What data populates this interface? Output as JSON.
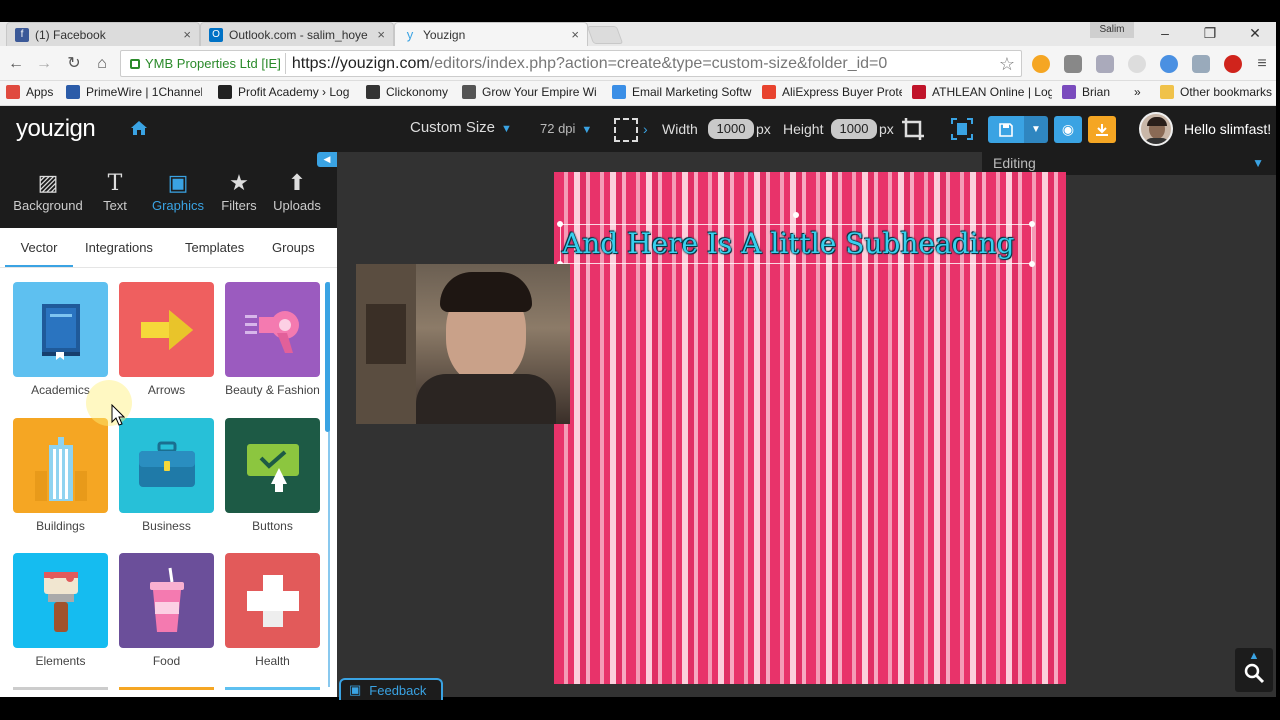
{
  "browser": {
    "tabs": [
      {
        "label": "(1) Facebook",
        "icon": "facebook-icon",
        "color": "#3b5998"
      },
      {
        "label": "Outlook.com - salim_hoye",
        "icon": "outlook-icon",
        "color": "#0072c6"
      },
      {
        "label": "Youzign",
        "icon": "youzign-icon",
        "color": "#3aa3e3"
      }
    ],
    "profile_name": "Salim",
    "ev_label": "YMB Properties Ltd [IE]",
    "url_host": "https://youzign.com",
    "url_path": "/editors/index.php?action=create&type=custom-size&folder_id=0",
    "bookmarks": [
      {
        "label": "Apps",
        "color": "#e04a3f"
      },
      {
        "label": "PrimeWire | 1Channel",
        "color": "#2b5ba8"
      },
      {
        "label": "Profit Academy › Log",
        "color": "#222222"
      },
      {
        "label": "Clickonomy",
        "color": "#333333"
      },
      {
        "label": "Grow Your Empire Wi",
        "color": "#555555"
      },
      {
        "label": "Email Marketing Softw",
        "color": "#3a8ee6"
      },
      {
        "label": "AliExpress Buyer Prote",
        "color": "#e8432e"
      },
      {
        "label": "ATHLEAN Online | Log",
        "color": "#c0142a"
      },
      {
        "label": "Brian",
        "color": "#7a4bbd"
      },
      {
        "label": "»",
        "color": "#f5f5f5"
      },
      {
        "label": "Other bookmarks",
        "color": "#f0c24a"
      }
    ]
  },
  "app": {
    "logo": "youzign",
    "size_select": "Custom Size",
    "dpi_select": "72 dpi",
    "width_label": "Width",
    "width_value": "1000",
    "height_label": "Height",
    "height_value": "1000",
    "unit": "px",
    "greeting": "Hello slimfast!",
    "editing_label": "Editing",
    "feedback_label": "Feedback"
  },
  "toolbar": [
    {
      "label": "Background",
      "icon": "background-icon",
      "glyph": "▨"
    },
    {
      "label": "Text",
      "icon": "text-icon",
      "glyph": "T"
    },
    {
      "label": "Graphics",
      "icon": "graphics-icon",
      "glyph": "▣"
    },
    {
      "label": "Filters",
      "icon": "filters-icon",
      "glyph": "★"
    },
    {
      "label": "Uploads",
      "icon": "uploads-icon",
      "glyph": "⬆"
    }
  ],
  "subtabs": [
    "Vector",
    "Integrations",
    "Templates",
    "Groups"
  ],
  "categories": [
    {
      "label": "Academics",
      "color": "#5ec0f0",
      "icon": "book-icon"
    },
    {
      "label": "Arrows",
      "color": "#ef5f5f",
      "icon": "arrow-icon"
    },
    {
      "label": "Beauty & Fashion",
      "color": "#9b5bbf",
      "icon": "hair-dryer-icon"
    },
    {
      "label": "Buildings",
      "color": "#f5a623",
      "icon": "building-icon"
    },
    {
      "label": "Business",
      "color": "#27c0d8",
      "icon": "briefcase-icon"
    },
    {
      "label": "Buttons",
      "color": "#1d5a45",
      "icon": "button-click-icon"
    },
    {
      "label": "Elements",
      "color": "#15bcf0",
      "icon": "paint-brush-icon"
    },
    {
      "label": "Food",
      "color": "#6b4f9a",
      "icon": "drink-cup-icon"
    },
    {
      "label": "Health",
      "color": "#e25a5a",
      "icon": "medical-cross-icon"
    }
  ],
  "canvas": {
    "text": "And Here Is A little Subheading"
  },
  "colors": {
    "accent": "#3aa3e3",
    "header": "#1c1c1c",
    "workspace": "#323232"
  }
}
